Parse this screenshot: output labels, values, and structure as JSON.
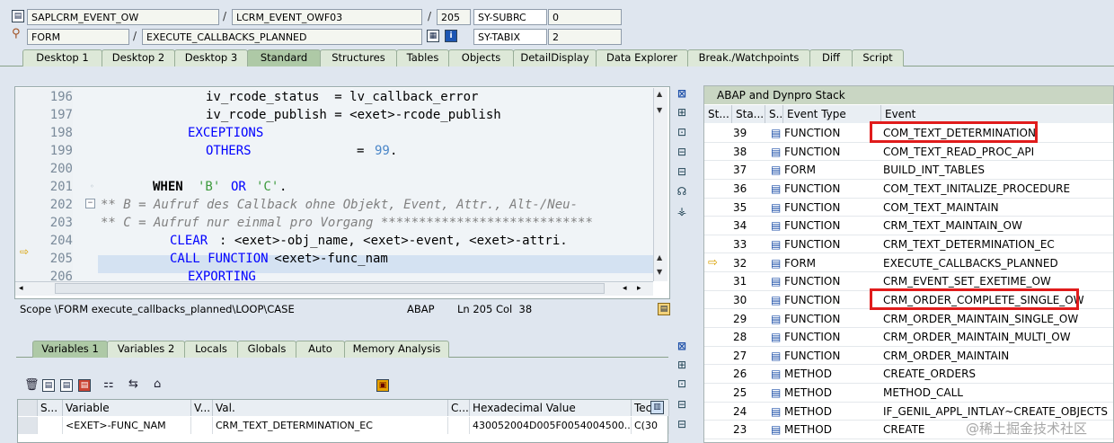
{
  "header": {
    "row1": {
      "program": "SAPLCRM_EVENT_OW",
      "include": "LCRM_EVENT_OWF03",
      "line": "205",
      "sysvar_name": "SY-SUBRC",
      "sysvar_value": "0"
    },
    "row2": {
      "type": "FORM",
      "name": "EXECUTE_CALLBACKS_PLANNED",
      "sysvar_name": "SY-TABIX",
      "sysvar_value": "2"
    },
    "separator": "/"
  },
  "main_tabs": [
    "Desktop 1",
    "Desktop 2",
    "Desktop 3",
    "Standard",
    "Structures",
    "Tables",
    "Objects",
    "DetailDisplay",
    "Data Explorer",
    "Break./Watchpoints",
    "Diff",
    "Script"
  ],
  "active_main_tab": "Standard",
  "code": {
    "lines": [
      {
        "num": "196",
        "text": "iv_rcode_status  = lv_callback_error"
      },
      {
        "num": "197",
        "text": "iv_rcode_publish = <exet>-rcode_publish"
      },
      {
        "num": "198",
        "text": "EXCEPTIONS"
      },
      {
        "num": "199",
        "text": "OTHERS",
        "eq": "=",
        "val": "99",
        "dot": "."
      },
      {
        "num": "200",
        "text": ""
      },
      {
        "num": "201",
        "text": "WHEN",
        "lit1": "'B'",
        "or": "OR",
        "lit2": "'C'",
        "dot": "."
      },
      {
        "num": "202",
        "text": "** B = Aufruf des Callback ohne Objekt, Event, Attr., Alt-/Neu-"
      },
      {
        "num": "203",
        "text": "** C = Aufruf nur einmal pro Vorgang ****************************"
      },
      {
        "num": "204",
        "text": "CLEAR",
        "rest": ": <exet>-obj_name, <exet>-event, <exet>-attri."
      },
      {
        "num": "205",
        "text": "CALL FUNCTION",
        "rest": " <exet>-func_nam"
      },
      {
        "num": "206",
        "text": "EXPORTING"
      }
    ],
    "current_line": "205"
  },
  "status_bar": {
    "scope": "Scope \\FORM execute_callbacks_planned\\LOOP\\CASE",
    "language": "ABAP",
    "position": "Ln 205 Col  38"
  },
  "stack": {
    "title": "ABAP and Dynpro Stack",
    "columns": [
      "St...",
      "Sta...",
      "S...",
      "Event Type",
      "Event"
    ],
    "rows": [
      {
        "level": "39",
        "type": "FUNCTION",
        "event": "COM_TEXT_DETERMINATION",
        "highlight": true
      },
      {
        "level": "38",
        "type": "FUNCTION",
        "event": "COM_TEXT_READ_PROC_API"
      },
      {
        "level": "37",
        "type": "FORM",
        "event": "BUILD_INT_TABLES"
      },
      {
        "level": "36",
        "type": "FUNCTION",
        "event": "COM_TEXT_INITALIZE_PROCEDURE"
      },
      {
        "level": "35",
        "type": "FUNCTION",
        "event": "COM_TEXT_MAINTAIN"
      },
      {
        "level": "34",
        "type": "FUNCTION",
        "event": "CRM_TEXT_MAINTAIN_OW"
      },
      {
        "level": "33",
        "type": "FUNCTION",
        "event": "CRM_TEXT_DETERMINATION_EC"
      },
      {
        "level": "32",
        "type": "FORM",
        "event": "EXECUTE_CALLBACKS_PLANNED",
        "current": true
      },
      {
        "level": "31",
        "type": "FUNCTION",
        "event": "CRM_EVENT_SET_EXETIME_OW"
      },
      {
        "level": "30",
        "type": "FUNCTION",
        "event": "CRM_ORDER_COMPLETE_SINGLE_OW",
        "highlight": true
      },
      {
        "level": "29",
        "type": "FUNCTION",
        "event": "CRM_ORDER_MAINTAIN_SINGLE_OW"
      },
      {
        "level": "28",
        "type": "FUNCTION",
        "event": "CRM_ORDER_MAINTAIN_MULTI_OW"
      },
      {
        "level": "27",
        "type": "FUNCTION",
        "event": "CRM_ORDER_MAINTAIN"
      },
      {
        "level": "26",
        "type": "METHOD",
        "event": "CREATE_ORDERS"
      },
      {
        "level": "25",
        "type": "METHOD",
        "event": "METHOD_CALL"
      },
      {
        "level": "24",
        "type": "METHOD",
        "event": "IF_GENIL_APPL_INTLAY~CREATE_OBJECTS"
      },
      {
        "level": "23",
        "type": "METHOD",
        "event": "CREATE"
      }
    ]
  },
  "var_tabs": [
    "Variables 1",
    "Variables 2",
    "Locals",
    "Globals",
    "Auto",
    "Memory Analysis"
  ],
  "active_var_tab": "Variables 1",
  "var_grid": {
    "columns": [
      "S...",
      "Variable",
      "V...",
      "Val.",
      "C...",
      "Hexadecimal Value",
      "Tec"
    ],
    "row": {
      "variable": "<EXET>-FUNC_NAM",
      "value": "CRM_TEXT_DETERMINATION_EC",
      "hex": "430052004D005F0054004500...",
      "tech": "C(30"
    }
  },
  "watermark": "@稀土掘金技术社区",
  "colors": {
    "background": "#dfe6ef",
    "active_tab": "#aec9a6",
    "highlight_box": "#e01c1c",
    "keyword": "#0000ff",
    "comment": "#808080",
    "literal": "#3c9a3c"
  }
}
